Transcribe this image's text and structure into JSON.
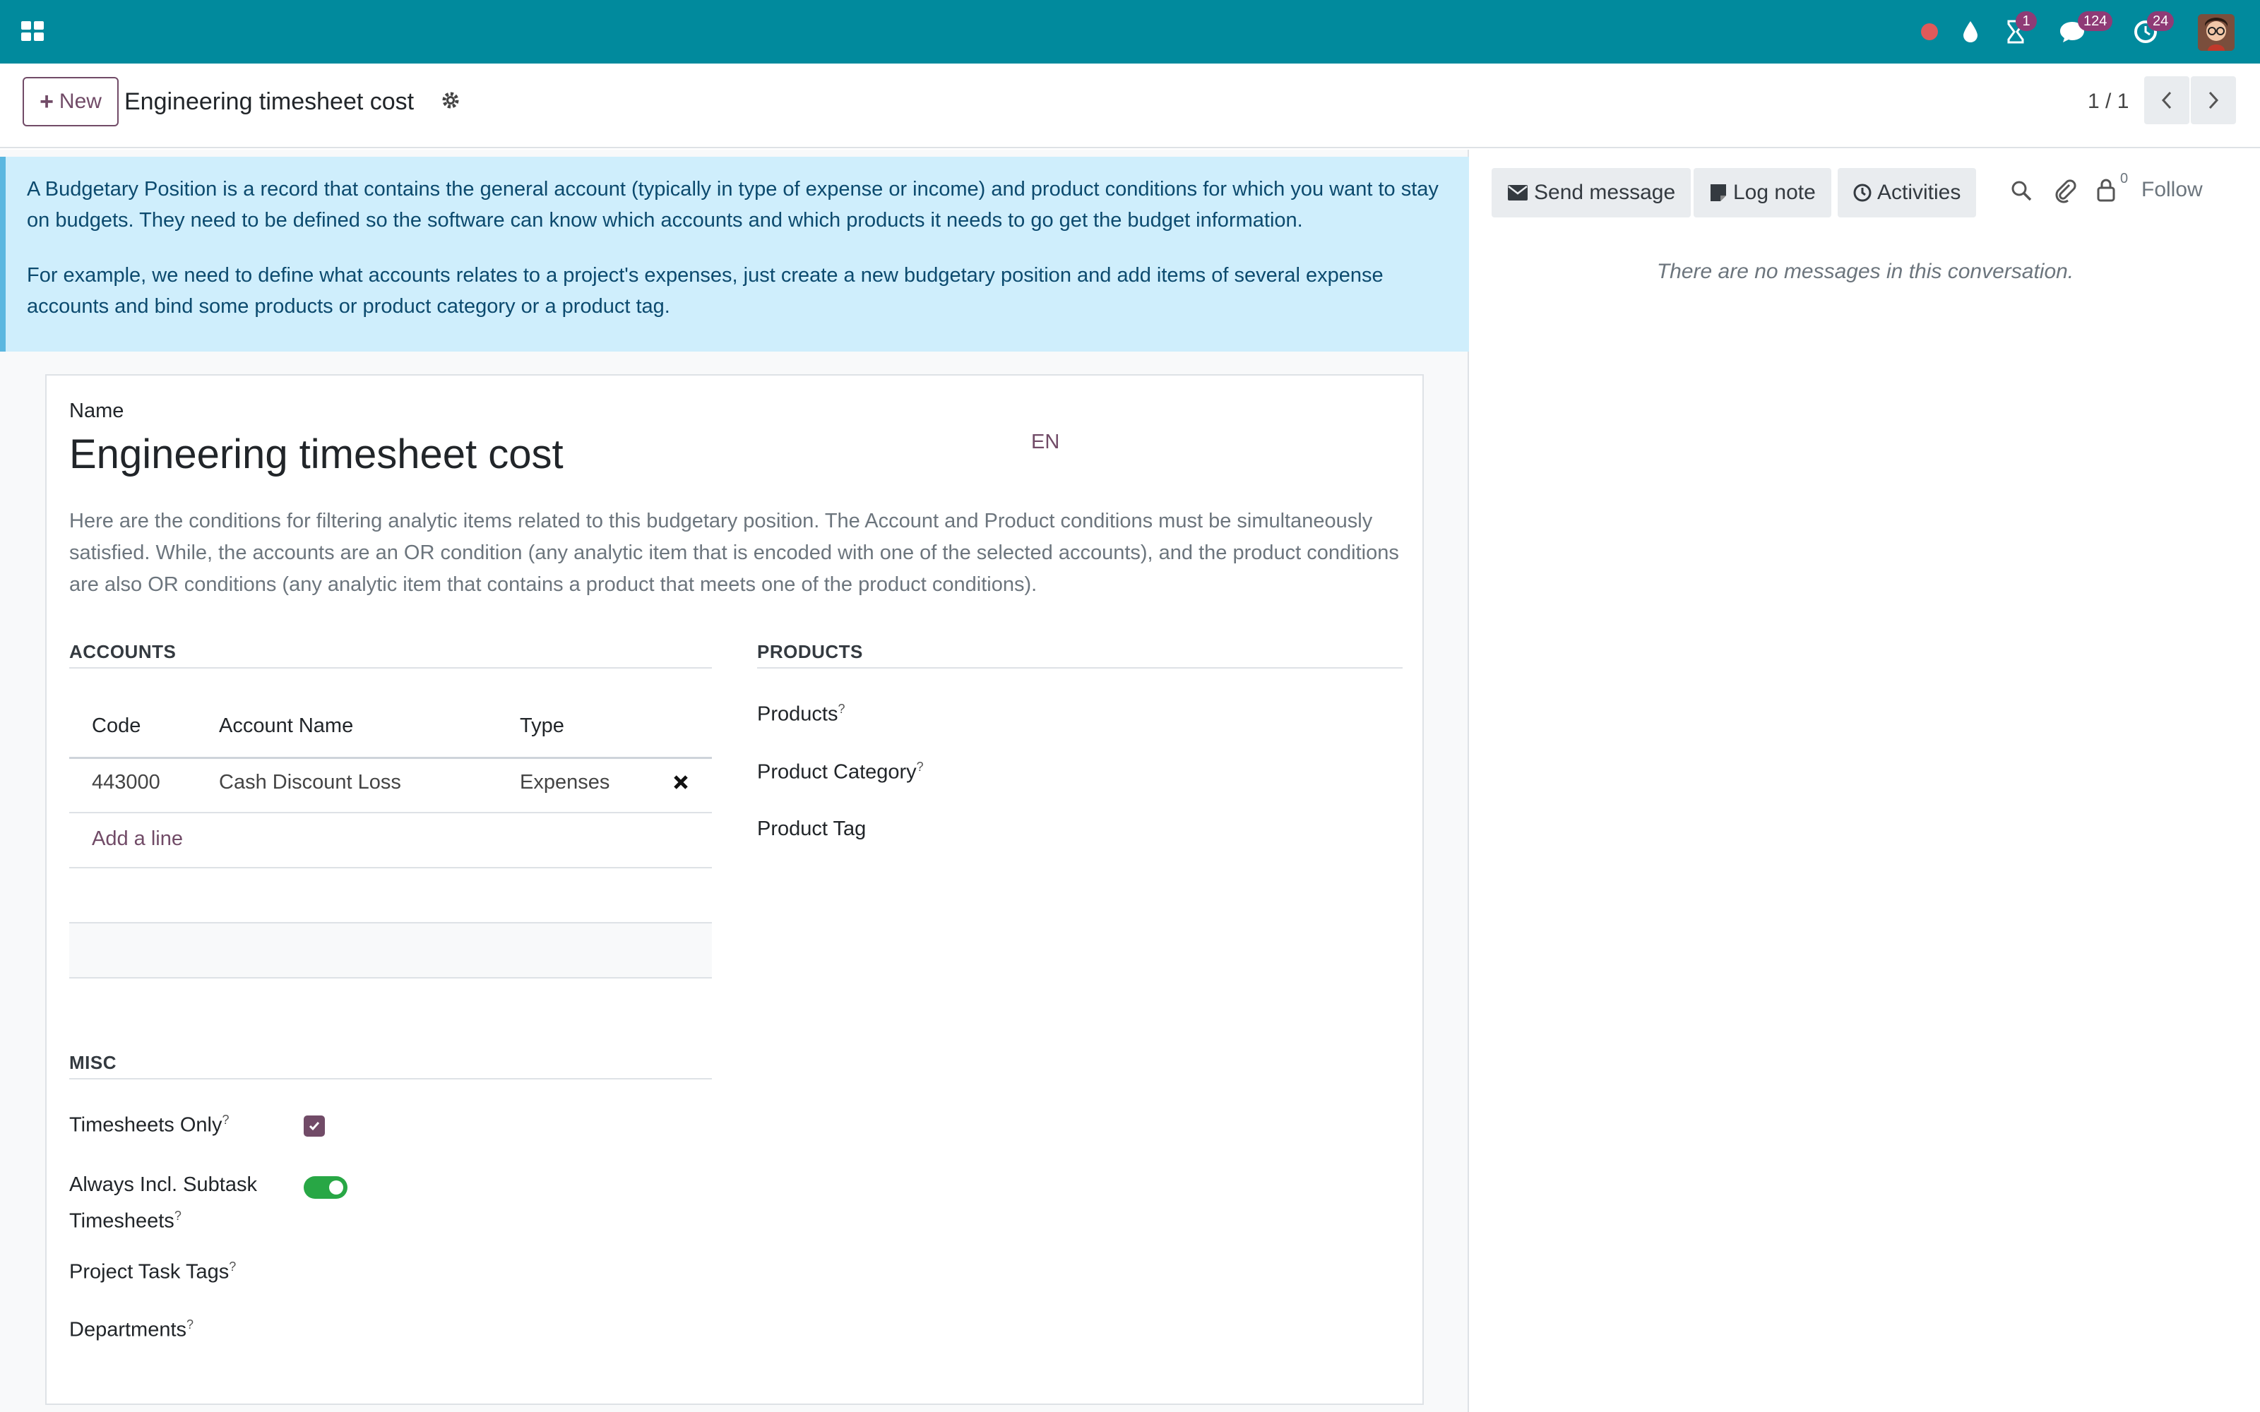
{
  "navbar": {
    "activities_badge": "1",
    "messages_badge": "124",
    "timer_badge": "24",
    "icons": [
      "apps-icon",
      "record-icon",
      "drop-icon",
      "hourglass-icon",
      "chat-icon",
      "clock-icon",
      "user-avatar"
    ],
    "color": "#018a9d"
  },
  "control_panel": {
    "new_label": "New",
    "breadcrumb": "Engineering timesheet cost",
    "pager": "1 / 1"
  },
  "alert": {
    "p1": "A Budgetary Position is a record that contains the general account (typically in type of expense or income) and product conditions for which you want to stay on budgets. They need to be defined so the software can know which accounts and which products it needs to go get the budget information.",
    "p2": "For example, we need to define what accounts relates to a project's expenses, just create a new budgetary position and add items of several expense accounts and bind some products or product category or a product tag."
  },
  "form": {
    "name_label": "Name",
    "name_value": "Engineering timesheet cost",
    "lang": "EN",
    "help": "Here are the conditions for filtering analytic items related to this budgetary position. The Account and Product conditions must be simultaneously satisfied. While, the accounts are an OR condition (any analytic item that is encoded with one of the selected accounts), and the product conditions are also OR conditions (any analytic item that contains a product that meets one of the product conditions).",
    "accounts": {
      "title": "ACCOUNTS",
      "columns": [
        "Code",
        "Account Name",
        "Type"
      ],
      "rows": [
        {
          "code": "443000",
          "name": "Cash Discount Loss",
          "type": "Expenses"
        }
      ],
      "add_line": "Add a line"
    },
    "products": {
      "title": "PRODUCTS",
      "products_label": "Products",
      "category_label": "Product Category",
      "tag_label": "Product Tag",
      "help_mark": "?"
    },
    "misc": {
      "title": "MISC",
      "timesheets_only_label": "Timesheets Only",
      "timesheets_only_value": true,
      "subtask_label_1": "Always Incl. Subtask",
      "subtask_label_2": "Timesheets",
      "subtask_value": true,
      "task_tags_label": "Project Task Tags",
      "departments_label": "Departments",
      "help_mark": "?"
    },
    "accent": "#714b67"
  },
  "chatter": {
    "send_message": "Send message",
    "log_note": "Log note",
    "activities": "Activities",
    "follower_count": "0",
    "follow": "Follow",
    "empty": "There are no messages in this conversation."
  }
}
